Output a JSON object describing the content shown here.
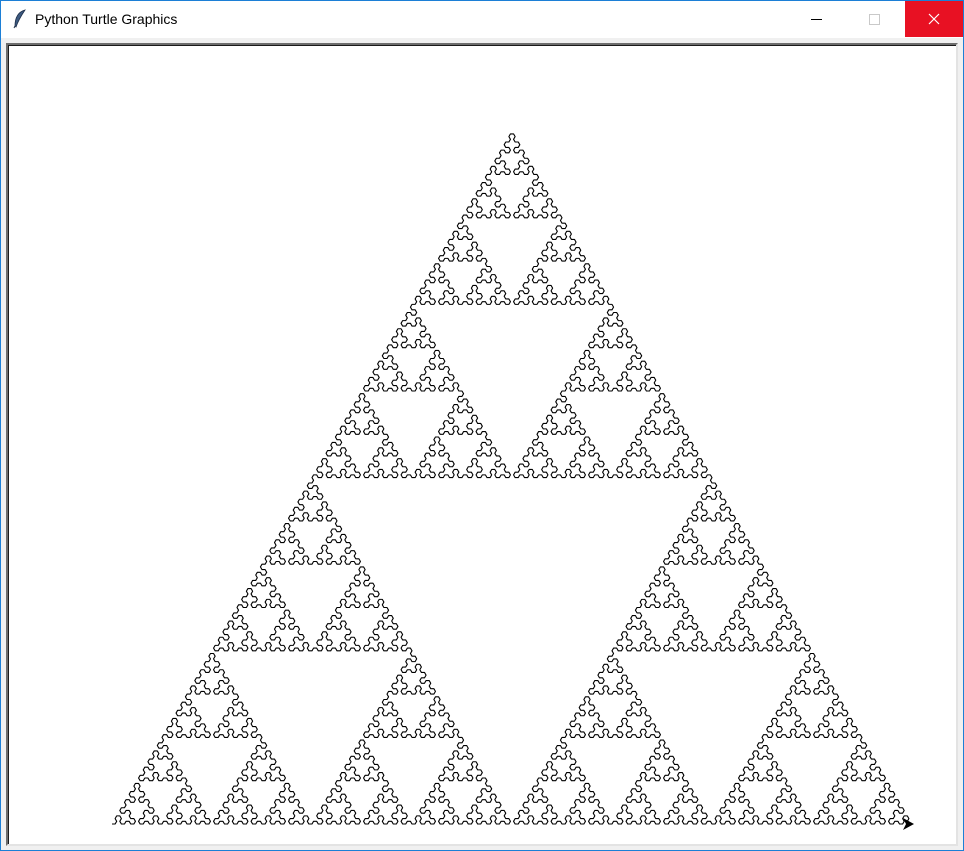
{
  "window": {
    "title": "Python Turtle Graphics",
    "icon": "feather-icon",
    "controls": {
      "minimize": "minimize-icon",
      "maximize": "maximize-icon",
      "close": "close-icon"
    },
    "close_color": "#e81123",
    "border_color": "#1c7fd6"
  },
  "canvas": {
    "background": "#ffffff",
    "drawing": {
      "type": "sierpinski-arrowhead-curve",
      "order": 8,
      "pen_color": "#000000",
      "start": "bottom-left",
      "end": "bottom-right",
      "turtle_heading": "east",
      "turtle_shape": "classic-arrow"
    }
  }
}
